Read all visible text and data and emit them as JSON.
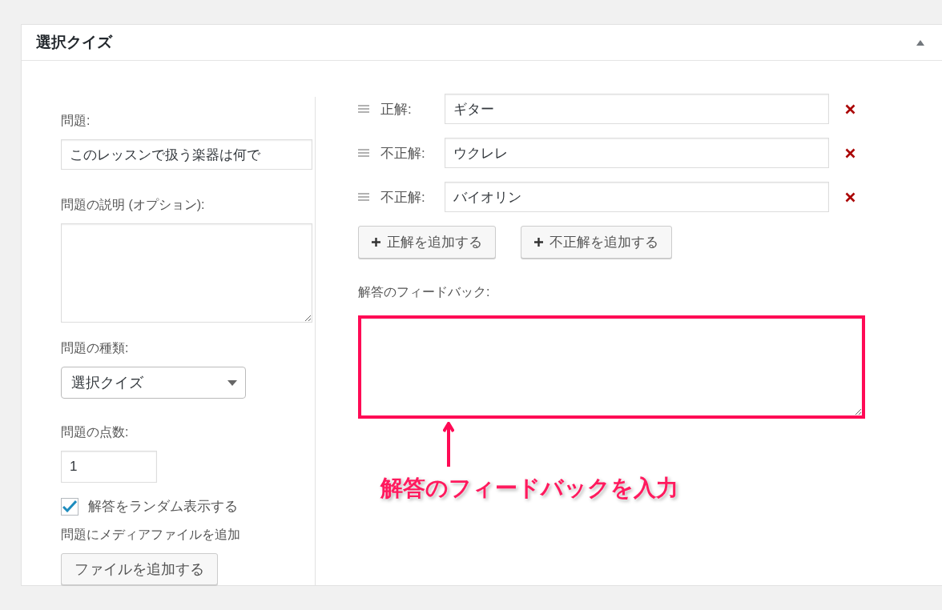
{
  "panel": {
    "title": "選択クイズ",
    "expanded": true
  },
  "question": {
    "label": "問題:",
    "value": "このレッスンで扱う楽器は何で"
  },
  "description": {
    "label": "問題の説明 (オプション):"
  },
  "type": {
    "label": "問題の種類:",
    "value": "選択クイズ"
  },
  "points": {
    "label": "問題の点数:",
    "value": "1"
  },
  "randomize": {
    "label": "解答をランダム表示する",
    "checked": true
  },
  "media": {
    "label": "問題にメディアファイルを追加",
    "button": "ファイルを追加する"
  },
  "answers": [
    {
      "label": "正解:",
      "value": "ギター"
    },
    {
      "label": "不正解:",
      "value": "ウクレレ"
    },
    {
      "label": "不正解:",
      "value": "バイオリン"
    }
  ],
  "add_buttons": [
    "正解を追加する",
    "不正解を追加する"
  ],
  "feedback": {
    "label": "解答のフィードバック:"
  },
  "annotation": {
    "text": "解答のフィードバックを入力"
  }
}
